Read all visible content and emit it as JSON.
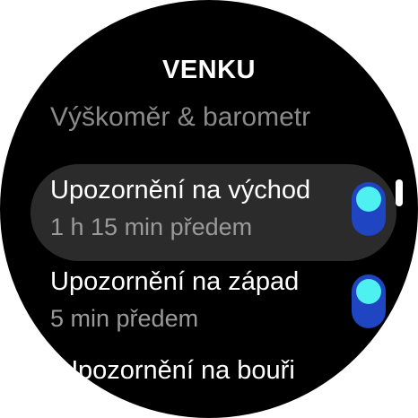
{
  "screen": {
    "title": "VENKU",
    "items": [
      {
        "title": "Výškoměr & barometr"
      },
      {
        "title": "Upozornění na východ",
        "subtitle": "1 h 15 min předem",
        "enabled": true
      },
      {
        "title": "Upozornění na západ",
        "subtitle": "5 min předem",
        "enabled": true
      },
      {
        "title": "Upozornění na bouři"
      }
    ]
  },
  "colors": {
    "background": "#000000",
    "highlight": "#2b2b2b",
    "toggle_track": "#1f45c2",
    "toggle_knob": "#4ef0f0"
  }
}
